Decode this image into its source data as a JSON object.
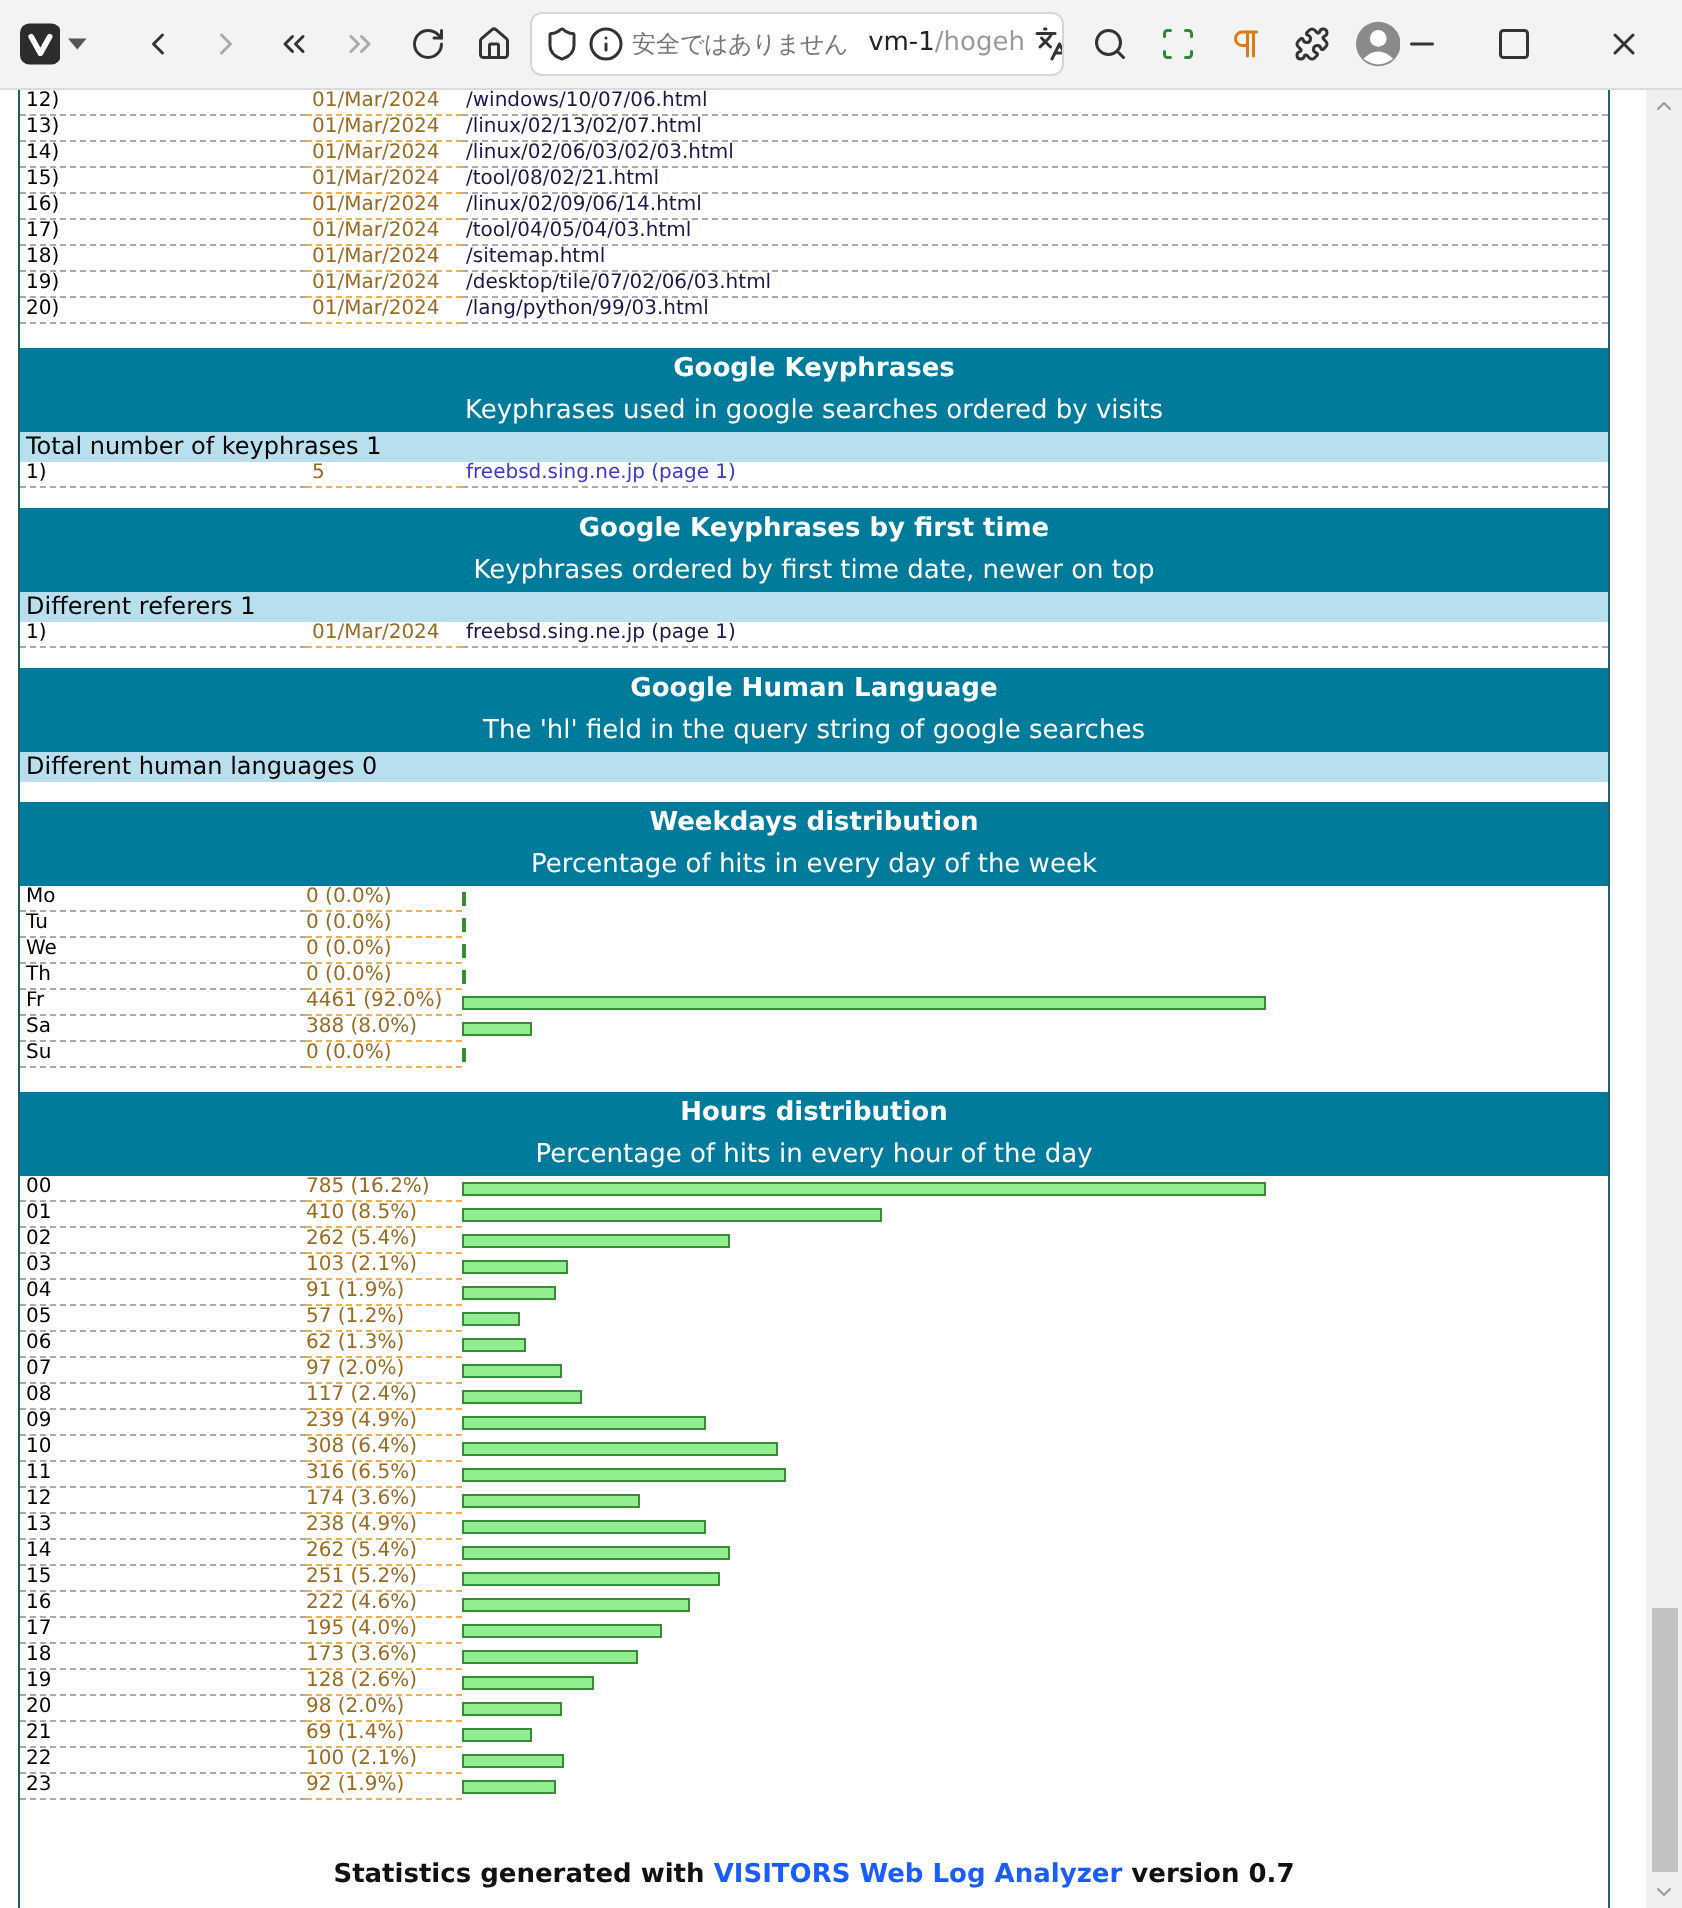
{
  "browser": {
    "security_label": "安全ではありません",
    "url_host": "vm-1",
    "url_path": "/hogeh"
  },
  "top_list": [
    {
      "rank": "12)",
      "date": "01/Mar/2024",
      "path": "/windows/10/07/06.html"
    },
    {
      "rank": "13)",
      "date": "01/Mar/2024",
      "path": "/linux/02/13/02/07.html"
    },
    {
      "rank": "14)",
      "date": "01/Mar/2024",
      "path": "/linux/02/06/03/02/03.html"
    },
    {
      "rank": "15)",
      "date": "01/Mar/2024",
      "path": "/tool/08/02/21.html"
    },
    {
      "rank": "16)",
      "date": "01/Mar/2024",
      "path": "/linux/02/09/06/14.html"
    },
    {
      "rank": "17)",
      "date": "01/Mar/2024",
      "path": "/tool/04/05/04/03.html"
    },
    {
      "rank": "18)",
      "date": "01/Mar/2024",
      "path": "/sitemap.html"
    },
    {
      "rank": "19)",
      "date": "01/Mar/2024",
      "path": "/desktop/tile/07/02/06/03.html"
    },
    {
      "rank": "20)",
      "date": "01/Mar/2024",
      "path": "/lang/python/99/03.html"
    }
  ],
  "sections": [
    {
      "kind": "list",
      "title": "Google Keyphrases",
      "subtitle": "Keyphrases used in google searches ordered by visits",
      "summary": "Total number of keyphrases 1",
      "rows": [
        {
          "label": "1)",
          "value": "5",
          "text": "freebsd.sing.ne.jp (page 1)",
          "link": true
        }
      ]
    },
    {
      "kind": "list",
      "title": "Google Keyphrases by first time",
      "subtitle": "Keyphrases ordered by first time date, newer on top",
      "summary": "Different referers 1",
      "rows": [
        {
          "label": "1)",
          "value": "01/Mar/2024",
          "text": "freebsd.sing.ne.jp (page 1)",
          "link": false
        }
      ]
    },
    {
      "kind": "list",
      "title": "Google Human Language",
      "subtitle": "The 'hl' field in the query string of google searches",
      "summary": "Different human languages 0"
    },
    {
      "kind": "bars",
      "title": "Weekdays distribution",
      "subtitle": "Percentage of hits in every day of the week",
      "rows": [
        {
          "label": "Mo",
          "value": "0 (0.0%)",
          "level": 0
        },
        {
          "label": "Tu",
          "value": "0 (0.0%)",
          "level": 0
        },
        {
          "label": "We",
          "value": "0 (0.0%)",
          "level": 0
        },
        {
          "label": "Th",
          "value": "0 (0.0%)",
          "level": 0
        },
        {
          "label": "Fr",
          "value": "4461 (92.0%)",
          "level": 1
        },
        {
          "label": "Sa",
          "value": "388 (8.0%)",
          "level": 0.087
        },
        {
          "label": "Su",
          "value": "0 (0.0%)",
          "level": 0
        }
      ]
    },
    {
      "kind": "bars",
      "title": "Hours distribution",
      "subtitle": "Percentage of hits in every hour of the day",
      "rows": [
        {
          "label": "00",
          "value": "785 (16.2%)",
          "level": 1
        },
        {
          "label": "01",
          "value": "410 (8.5%)",
          "level": 0.522
        },
        {
          "label": "02",
          "value": "262 (5.4%)",
          "level": 0.334
        },
        {
          "label": "03",
          "value": "103 (2.1%)",
          "level": 0.131
        },
        {
          "label": "04",
          "value": "91 (1.9%)",
          "level": 0.116
        },
        {
          "label": "05",
          "value": "57 (1.2%)",
          "level": 0.073
        },
        {
          "label": "06",
          "value": "62 (1.3%)",
          "level": 0.079
        },
        {
          "label": "07",
          "value": "97 (2.0%)",
          "level": 0.124
        },
        {
          "label": "08",
          "value": "117 (2.4%)",
          "level": 0.149
        },
        {
          "label": "09",
          "value": "239 (4.9%)",
          "level": 0.304
        },
        {
          "label": "10",
          "value": "308 (6.4%)",
          "level": 0.392
        },
        {
          "label": "11",
          "value": "316 (6.5%)",
          "level": 0.403
        },
        {
          "label": "12",
          "value": "174 (3.6%)",
          "level": 0.222
        },
        {
          "label": "13",
          "value": "238 (4.9%)",
          "level": 0.303
        },
        {
          "label": "14",
          "value": "262 (5.4%)",
          "level": 0.334
        },
        {
          "label": "15",
          "value": "251 (5.2%)",
          "level": 0.32
        },
        {
          "label": "16",
          "value": "222 (4.6%)",
          "level": 0.283
        },
        {
          "label": "17",
          "value": "195 (4.0%)",
          "level": 0.248
        },
        {
          "label": "18",
          "value": "173 (3.6%)",
          "level": 0.22
        },
        {
          "label": "19",
          "value": "128 (2.6%)",
          "level": 0.163
        },
        {
          "label": "20",
          "value": "98 (2.0%)",
          "level": 0.125
        },
        {
          "label": "21",
          "value": "69 (1.4%)",
          "level": 0.088
        },
        {
          "label": "22",
          "value": "100 (2.1%)",
          "level": 0.127
        },
        {
          "label": "23",
          "value": "92 (1.9%)",
          "level": 0.117
        }
      ]
    }
  ],
  "footer": {
    "prefix": "Statistics generated with",
    "link": "VISITORS Web Log Analyzer",
    "suffix": "version 0.7"
  }
}
